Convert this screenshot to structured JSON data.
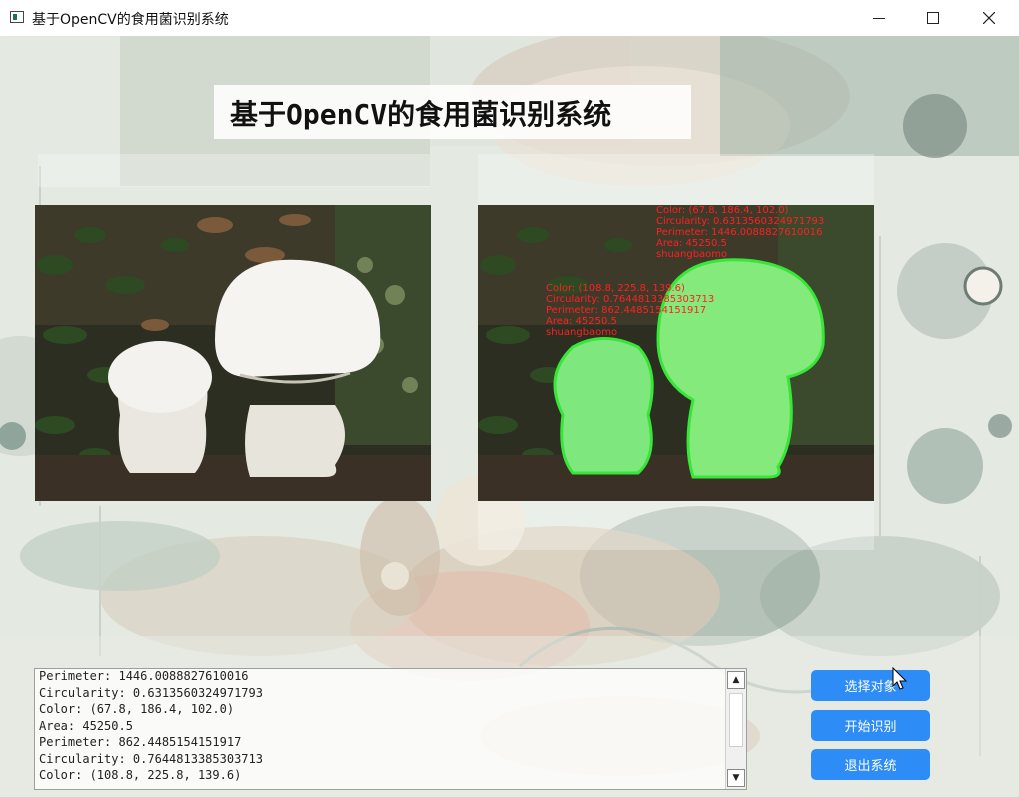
{
  "window": {
    "title": "基于OpenCV的食用菌识别系统"
  },
  "header": {
    "title": "基于OpenCV的食用菌识别系统"
  },
  "images": {
    "left": {
      "name": "original-mushroom-image"
    },
    "right": {
      "name": "processed-mushroom-image",
      "annotations": [
        {
          "lines": [
            "Color: (67.8, 186.4, 102.0)",
            "Circularity: 0.6313560324971793",
            "Perimeter: 1446.0088827610016",
            "Area: 45250.5",
            "shuangbaomo"
          ]
        },
        {
          "lines": [
            "Color: (108.8, 225.8, 139.6)",
            "Circularity: 0.7644813385303713",
            "Perimeter: 862.4485154151917",
            "Area: 45250.5",
            "shuangbaomo"
          ]
        }
      ]
    }
  },
  "output": {
    "lines": [
      "Perimeter: 1446.0088827610016",
      "Circularity: 0.6313560324971793",
      "Color: (67.8, 186.4, 102.0)",
      "Area: 45250.5",
      "Perimeter: 862.4485154151917",
      "Circularity: 0.7644813385303713",
      "Color: (108.8, 225.8, 139.6)"
    ]
  },
  "buttons": {
    "select": "选择对象",
    "start": "开始识别",
    "exit": "退出系统"
  },
  "colors": {
    "button": "#2d8cf6",
    "annotation_text": "#ff2020",
    "contour": "#37e637",
    "fill": "#7ee87e"
  },
  "icons": {
    "app": "window-app-icon",
    "minimize": "minimize-icon",
    "maximize": "maximize-icon",
    "close": "close-icon",
    "scroll_up": "scroll-up-arrow-icon",
    "scroll_down": "scroll-down-arrow-icon",
    "cursor": "mouse-pointer-icon"
  }
}
